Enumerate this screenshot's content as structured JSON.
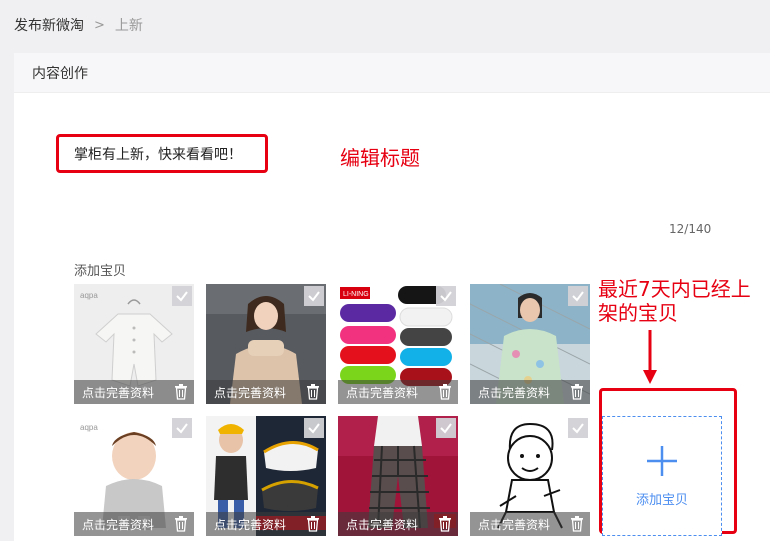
{
  "breadcrumb": {
    "root": "发布新微淘",
    "separator": ">",
    "current": "上新"
  },
  "panel": {
    "title": "内容创作"
  },
  "editor": {
    "title_value": "掌柜有上新，快来看看吧！",
    "counter": "12/140"
  },
  "annotations": {
    "edit_title": "编辑标题",
    "recent_items": "最近7天内已经上架的宝贝"
  },
  "products": {
    "label": "添加宝贝",
    "overlay_text": "点击完善资料",
    "add_label": "添加宝贝",
    "items": [
      {
        "logo": "aqpa"
      },
      {
        "logo": ""
      },
      {
        "logo": "LI-NING"
      },
      {
        "logo": ""
      },
      {
        "logo": "aqpa"
      },
      {
        "logo": ""
      },
      {
        "logo": ""
      },
      {
        "logo": ""
      }
    ]
  },
  "colors": {
    "annotation_red": "#e60012",
    "accent_blue": "#4c8ef0"
  }
}
